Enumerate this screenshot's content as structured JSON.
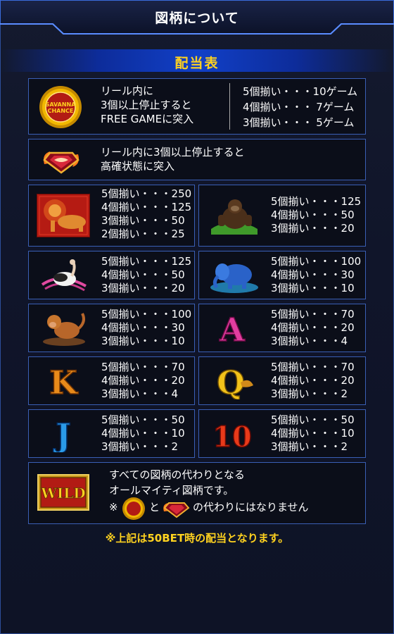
{
  "header": {
    "title": "図柄について"
  },
  "section": {
    "title": "配当表"
  },
  "chance": {
    "description": [
      "リール内に",
      "3個以上停止すると",
      "FREE GAMEに突入"
    ],
    "logo_text": [
      "SAVANNA",
      "CHANCE"
    ],
    "payouts": [
      "5個揃い・・・10ゲーム",
      "4個揃い・・・ 7ゲーム",
      "3個揃い・・・ 5ゲーム"
    ]
  },
  "gem": {
    "description": [
      "リール内に3個以上停止すると",
      "高確状態に突入"
    ]
  },
  "symbols": [
    {
      "name": "lion",
      "icon": "lion-icon",
      "payouts": [
        "5個揃い・・・250",
        "4個揃い・・・125",
        "3個揃い・・・50",
        "2個揃い・・・25"
      ]
    },
    {
      "name": "gorilla",
      "icon": "gorilla-icon",
      "payouts": [
        "5個揃い・・・125",
        "4個揃い・・・50",
        "3個揃い・・・20"
      ]
    },
    {
      "name": "ostrich",
      "icon": "ostrich-icon",
      "payouts": [
        "5個揃い・・・125",
        "4個揃い・・・50",
        "3個揃い・・・20"
      ]
    },
    {
      "name": "elephant",
      "icon": "elephant-icon",
      "payouts": [
        "5個揃い・・・100",
        "4個揃い・・・30",
        "3個揃い・・・10"
      ]
    },
    {
      "name": "monkey",
      "icon": "monkey-icon",
      "payouts": [
        "5個揃い・・・100",
        "4個揃い・・・30",
        "3個揃い・・・10"
      ]
    },
    {
      "name": "A",
      "icon": "letter-a-icon",
      "glyph": "A",
      "payouts": [
        "5個揃い・・・70",
        "4個揃い・・・20",
        "3個揃い・・・4"
      ]
    },
    {
      "name": "K",
      "icon": "letter-k-icon",
      "glyph": "K",
      "payouts": [
        "5個揃い・・・70",
        "4個揃い・・・20",
        "3個揃い・・・4"
      ]
    },
    {
      "name": "Q",
      "icon": "letter-q-icon",
      "glyph": "Q",
      "payouts": [
        "5個揃い・・・70",
        "4個揃い・・・20",
        "3個揃い・・・2"
      ]
    },
    {
      "name": "J",
      "icon": "letter-j-icon",
      "glyph": "J",
      "payouts": [
        "5個揃い・・・50",
        "4個揃い・・・10",
        "3個揃い・・・2"
      ]
    },
    {
      "name": "10",
      "icon": "number-10-icon",
      "glyph": "10",
      "payouts": [
        "5個揃い・・・50",
        "4個揃い・・・10",
        "3個揃い・・・2"
      ]
    }
  ],
  "wild": {
    "logo_text": "WILD",
    "line1": "すべての図柄の代わりとなる",
    "line2": "オールマイティ図柄です。",
    "line3_prefix": "※",
    "line3_and": "と",
    "line3_suffix": "の代わりにはなりません"
  },
  "footer": {
    "note": "※上記は50BET時の配当となります。"
  },
  "colors": {
    "accent": "#ffd21f",
    "border": "#3a5fb5",
    "panel": "#0b0e19"
  }
}
